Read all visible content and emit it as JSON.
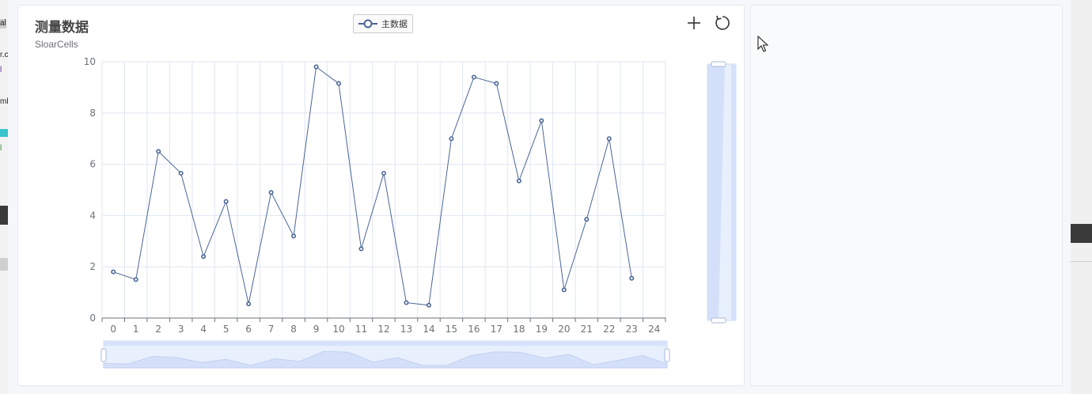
{
  "left_fragments": [
    "al",
    "r.c",
    "l",
    "ml",
    "l"
  ],
  "chart": {
    "title": "测量数据",
    "subtitle": "SloarCells",
    "legend_label": "主数据",
    "toolbox": {
      "add_icon": "plus-icon",
      "reset_icon": "refresh-icon"
    }
  },
  "colors": {
    "line": "#5470c6",
    "line_dark": "#4a6597",
    "grid": "#e0e6f1",
    "slider_fill": "#d4e0f9",
    "slider_track": "#e8effd"
  },
  "chart_data": {
    "type": "line",
    "title": "测量数据",
    "subtitle": "SloarCells",
    "x": [
      0,
      1,
      2,
      3,
      4,
      5,
      6,
      7,
      8,
      9,
      10,
      11,
      12,
      13,
      14,
      15,
      16,
      17,
      18,
      19,
      20,
      21,
      22,
      23,
      24
    ],
    "series": [
      {
        "name": "主数据",
        "values": [
          1.8,
          1.5,
          6.5,
          5.65,
          2.4,
          4.55,
          0.55,
          4.9,
          3.2,
          9.8,
          9.15,
          2.7,
          5.65,
          0.6,
          0.5,
          7.0,
          9.4,
          9.15,
          5.35,
          7.7,
          1.1,
          3.85,
          7.0,
          1.55
        ]
      }
    ],
    "xlabel": "",
    "ylabel": "",
    "yticks": [
      0,
      2,
      4,
      6,
      8,
      10
    ],
    "ylim": [
      0,
      10
    ],
    "xlim": [
      0,
      24
    ],
    "grid": true,
    "legend_position": "top-center",
    "marker": "circle",
    "datazoom_x": "slider-bottom",
    "datazoom_y": "slider-right"
  }
}
